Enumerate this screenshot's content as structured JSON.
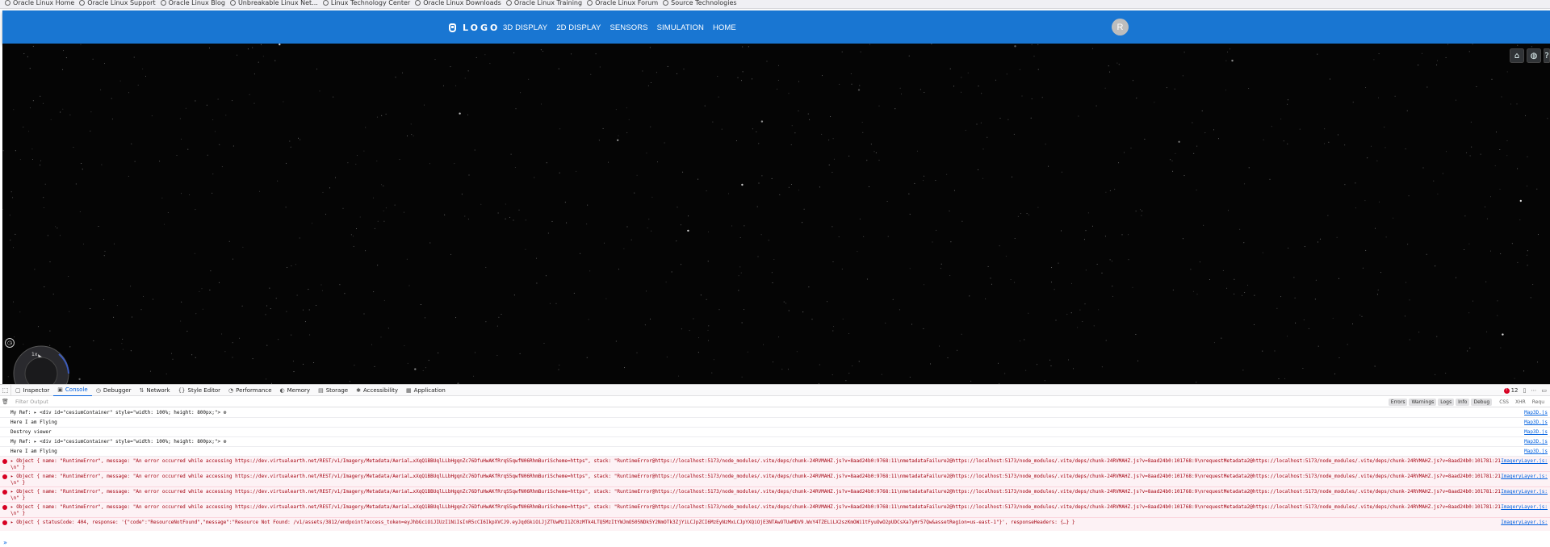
{
  "bookmarks": [
    "Oracle Linux Home",
    "Oracle Linux Support",
    "Oracle Linux Blog",
    "Unbreakable Linux Net...",
    "Linux Technology Center",
    "Oracle Linux Downloads",
    "Oracle Linux Training",
    "Oracle Linux Forum",
    "Source Technologies"
  ],
  "navbar": {
    "logo_text": "LOGO",
    "links": [
      "3D DISPLAY",
      "2D DISPLAY",
      "SENSORS",
      "SIMULATION",
      "HOME"
    ],
    "avatar_initial": "R",
    "color": "#1976d2"
  },
  "viewer": {
    "speed_label": "1x",
    "buttons": [
      "home-icon",
      "globe-icon",
      "help-icon"
    ]
  },
  "devtools": {
    "tabs": [
      {
        "label": "Inspector",
        "icon": "▢"
      },
      {
        "label": "Console",
        "icon": "▣"
      },
      {
        "label": "Debugger",
        "icon": "◷"
      },
      {
        "label": "Network",
        "icon": "⇅"
      },
      {
        "label": "Style Editor",
        "icon": "{}"
      },
      {
        "label": "Performance",
        "icon": "◔"
      },
      {
        "label": "Memory",
        "icon": "◐"
      },
      {
        "label": "Storage",
        "icon": "▤"
      },
      {
        "label": "Accessibility",
        "icon": "✱"
      },
      {
        "label": "Application",
        "icon": "▦"
      }
    ],
    "error_count": "12",
    "filter_placeholder": "Filter Output",
    "levels": [
      "Errors",
      "Warnings",
      "Logs",
      "Info",
      "Debug"
    ],
    "extra_filters": [
      "CSS",
      "XHR",
      "Requ"
    ],
    "rows": [
      {
        "type": "log",
        "text": "My Ref:  ▸ <div id=\"cesiumContainer\" style=\"width: 100%; height: 800px;\"> ⚙",
        "src": "Map3D.js"
      },
      {
        "type": "log",
        "text": "Here I am Flying",
        "src": "Map3D.js"
      },
      {
        "type": "log",
        "text": "Destroy viewer",
        "src": "Map3D.js"
      },
      {
        "type": "log",
        "text": "My Ref:  ▸ <div id=\"cesiumContainer\" style=\"width: 100%; height: 800px;\"> ⚙",
        "src": "Map3D.js"
      },
      {
        "type": "log",
        "text": "Here I am Flying",
        "src": "Map3D.js"
      },
      {
        "type": "err",
        "text": "▸ Object { name: \"RuntimeError\", message: \"An error occurred while accessing https://dev.virtualearth.net/REST/v1/Imagery/Metadata/Aerial…xXqQ1BBUqlLLbHgqnZc76DfuHwAKfRrqS5qwfN06RhmBuriScheme=https\", stack: \"RuntimeError@https://localhost:5173/node_modules/.vite/deps/chunk-24RVMAHZ.js?v=8aad24b0:9768:11\\nmetadataFailure2@https://localhost:5173/node_modules/.vite/deps/chunk-24RVMAHZ.js?v=8aad24b0:101768:9\\nrequestMetadata2@https://localhost:5173/node_modules/.vite/deps/chunk-24RVMAHZ.js?v=8aad24b0:101781:21\\n\" }",
        "src": "ImageryLayer.js:"
      },
      {
        "type": "err",
        "text": "▸ Object { name: \"RuntimeError\", message: \"An error occurred while accessing https://dev.virtualearth.net/REST/v1/Imagery/Metadata/Aerial…xXqQ1BBUqlLLbHgqnZc76DfuHwAKfRrqS5qwfN06RhmBuriScheme=https\", stack: \"RuntimeError@https://localhost:5173/node_modules/.vite/deps/chunk-24RVMAHZ.js?v=8aad24b0:9768:11\\nmetadataFailure2@https://localhost:5173/node_modules/.vite/deps/chunk-24RVMAHZ.js?v=8aad24b0:101768:9\\nrequestMetadata2@https://localhost:5173/node_modules/.vite/deps/chunk-24RVMAHZ.js?v=8aad24b0:101781:21\\n\" }",
        "src": "ImageryLayer.js:"
      },
      {
        "type": "err",
        "text": "▸ Object { name: \"RuntimeError\", message: \"An error occurred while accessing https://dev.virtualearth.net/REST/v1/Imagery/Metadata/Aerial…xXqQ1BBUqlLLbHgqnZc76DfuHwAKfRrqS5qwfN06RhmBuriScheme=https\", stack: \"RuntimeError@https://localhost:5173/node_modules/.vite/deps/chunk-24RVMAHZ.js?v=8aad24b0:9768:11\\nmetadataFailure2@https://localhost:5173/node_modules/.vite/deps/chunk-24RVMAHZ.js?v=8aad24b0:101768:9\\nrequestMetadata2@https://localhost:5173/node_modules/.vite/deps/chunk-24RVMAHZ.js?v=8aad24b0:101781:21\\n\" }",
        "src": "ImageryLayer.js:"
      },
      {
        "type": "err",
        "text": "▸ Object { name: \"RuntimeError\", message: \"An error occurred while accessing https://dev.virtualearth.net/REST/v1/Imagery/Metadata/Aerial…xXqQ1BBUqlLLbHgqnZc76DfuHwAKfRrqS5qwfN06RhmBuriScheme=https\", stack: \"RuntimeError@https://localhost:5173/node_modules/.vite/deps/chunk-24RVMAHZ.js?v=8aad24b0:9768:11\\nmetadataFailure2@https://localhost:5173/node_modules/.vite/deps/chunk-24RVMAHZ.js?v=8aad24b0:101768:9\\nrequestMetadata2@https://localhost:5173/node_modules/.vite/deps/chunk-24RVMAHZ.js?v=8aad24b0:101781:21\\n\" }",
        "src": "ImageryLayer.js:"
      },
      {
        "type": "err",
        "text": "▸ Object { statusCode: 404, response: '{\"code\":\"ResourceNotFound\",\"message\":\"Resource Not Found: /v1/assets/3812/endpoint?access_token=eyJhbGciOiJIUzI1NiIsInR5cCI6IkpXVCJ9.eyJqdGkiOiJjZTUwMzI1ZC0zMTk4LTQ5MzItYWJmOS05NDk5Y2NmOTk3ZjYiLCJpZCI6MzEyNzMxLCJpYXQiOjE3NTAwOTUwMDV9.WxY4TZELiLX2szKmOWi1tFyuOwO2pUDCsXa7yHr57Qw&assetRegion=us-east-1\"}', responseHeaders: {…} }",
        "src": "ImageryLayer.js:"
      }
    ],
    "prompt": "»"
  }
}
